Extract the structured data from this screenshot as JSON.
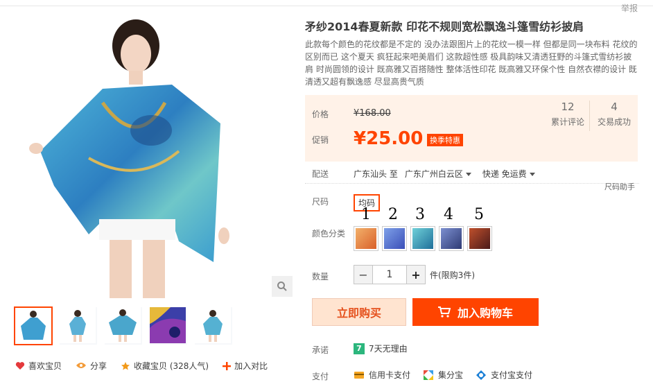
{
  "header": {
    "report_label": "举报"
  },
  "product": {
    "title": "矛纱2014春夏新款 印花不规则宽松飘逸斗篷雪纺衫披肩",
    "description": "此款每个颜色的花纹都是不定的 没办法跟图片上的花纹一模一样 但都是同一块布料 花纹的区别而已 这个夏天 疯狂起来吧美眉们 这款超性感 极具韵味又清透狂野的斗篷式雪纺衫披肩 时尚圆领的设计 既高雅又百搭随性 整体活性印花 既高雅又环保个性 自然衣襟的设计 既清透又超有飘逸感 尽显高贵气质"
  },
  "price": {
    "price_label": "价格",
    "original": "¥168.00",
    "promo_label": "促销",
    "promo_price": "¥25.00",
    "promo_tag": "换季特惠"
  },
  "stats": [
    {
      "number": "12",
      "label": "累计评论"
    },
    {
      "number": "4",
      "label": "交易成功"
    }
  ],
  "shipping": {
    "label": "配送",
    "from": "广东汕头 至",
    "to": "广东广州白云区",
    "method": "快递 免运费"
  },
  "size": {
    "label": "尺码",
    "option": "均码",
    "helper": "尺码助手"
  },
  "colors": {
    "label": "颜色分类",
    "numbers": [
      "1",
      "2",
      "3",
      "4",
      "5"
    ],
    "swatches": [
      {
        "name": "color-1",
        "color": "#e07a3a"
      },
      {
        "name": "color-2",
        "color": "#5c6fd1"
      },
      {
        "name": "color-3",
        "color": "#2c8fa8"
      },
      {
        "name": "color-4",
        "color": "#4a5d9a"
      },
      {
        "name": "color-5",
        "color": "#8a2a2a"
      }
    ]
  },
  "quantity": {
    "label": "数量",
    "value": "1",
    "minus": "−",
    "plus": "+",
    "note": "件(限购3件)"
  },
  "buttons": {
    "buy_now": "立即购买",
    "add_to_cart": "加入购物车"
  },
  "promise": {
    "label": "承诺",
    "badge": "7",
    "text": "7天无理由"
  },
  "payment": {
    "label": "支付",
    "methods": [
      "信用卡支付",
      "集分宝",
      "支付宝支付"
    ]
  },
  "gallery_actions": [
    {
      "icon": "heart-icon",
      "label": "喜欢宝贝"
    },
    {
      "icon": "share-icon",
      "label": "分享"
    },
    {
      "icon": "star-icon",
      "label": "收藏宝贝 (328人气)"
    },
    {
      "icon": "plus-icon",
      "label": "加入对比"
    }
  ],
  "colors_theme": {
    "accent": "#ff4400",
    "price_bg": "#fff2e8"
  }
}
